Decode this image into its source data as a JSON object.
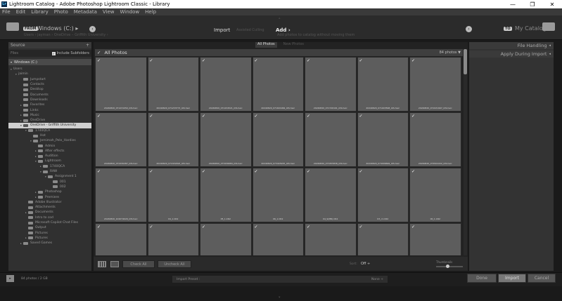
{
  "window": {
    "title": "Lightroom Catalog - Adobe Photoshop Lightroom Classic - Library",
    "app_icon": "Lr",
    "minimize": "—",
    "maximize": "❐",
    "close": "✕"
  },
  "menu": [
    "File",
    "Edit",
    "Library",
    "Photo",
    "Metadata",
    "View",
    "Window",
    "Help"
  ],
  "import_header": {
    "from_badge": "FROM",
    "source": "Windows (C:)",
    "source_arrow": "▸",
    "source_path": "Users › jayman › OneDrive – Griffith University ›",
    "left_nav": "‹",
    "modes": {
      "import": "Import",
      "embedded_culling": "Assisted Culling",
      "add": "Add",
      "add_arrow": "›"
    },
    "mode_description": "Add photos to catalog without moving them",
    "right_nav": "›",
    "to_badge": "TO",
    "destination": "My Catalog"
  },
  "source_panel": {
    "title": "Source",
    "add": "+",
    "filter_label": "Files",
    "include_subfolders_label": "Include Subfolders",
    "include_subfolders_checked": true,
    "volume": "Windows (C:)",
    "tree": [
      {
        "label": "Users",
        "depth": 0,
        "arrow": "▾",
        "folder": false
      },
      {
        "label": "jaimin",
        "depth": 1,
        "arrow": "▾",
        "folder": false
      },
      {
        "label": "Jumpstart",
        "depth": 2,
        "arrow": "",
        "folder": true
      },
      {
        "label": "Contacts",
        "depth": 2,
        "arrow": "",
        "folder": true
      },
      {
        "label": "Desktop",
        "depth": 2,
        "arrow": "",
        "folder": true
      },
      {
        "label": "Documents",
        "depth": 2,
        "arrow": "",
        "folder": true
      },
      {
        "label": "Downloads",
        "depth": 2,
        "arrow": "",
        "folder": true
      },
      {
        "label": "Favorites",
        "depth": 2,
        "arrow": "▸",
        "folder": true
      },
      {
        "label": "Links",
        "depth": 2,
        "arrow": "",
        "folder": true
      },
      {
        "label": "Music",
        "depth": 2,
        "arrow": "▸",
        "folder": true
      },
      {
        "label": "OneDrive",
        "depth": 2,
        "arrow": "▸",
        "folder": true
      },
      {
        "label": "OneDrive - Griffith University",
        "depth": 2,
        "arrow": "▾",
        "folder": true,
        "selected": true
      },
      {
        "label": "1740QCA",
        "depth": 3,
        "arrow": "▾",
        "folder": true
      },
      {
        "label": "Hot",
        "depth": 4,
        "arrow": "",
        "folder": true
      },
      {
        "label": "Jemimah_Pele_Hardies",
        "depth": 4,
        "arrow": "▾",
        "folder": true
      },
      {
        "label": "Admin",
        "depth": 5,
        "arrow": "",
        "folder": true
      },
      {
        "label": "After effects",
        "depth": 5,
        "arrow": "▸",
        "folder": true
      },
      {
        "label": "Audition",
        "depth": 5,
        "arrow": "▸",
        "folder": true
      },
      {
        "label": "Lightroom",
        "depth": 5,
        "arrow": "▾",
        "folder": true
      },
      {
        "label": "1740QCA",
        "depth": 6,
        "arrow": "▸",
        "folder": true
      },
      {
        "label": "RAW",
        "depth": 6,
        "arrow": "▾",
        "folder": true
      },
      {
        "label": "Assignment 1",
        "depth": 7,
        "arrow": "▾",
        "folder": true
      },
      {
        "label": "001",
        "depth": 8,
        "arrow": "",
        "folder": true
      },
      {
        "label": "002",
        "depth": 8,
        "arrow": "",
        "folder": true
      },
      {
        "label": "Photoshop",
        "depth": 5,
        "arrow": "▸",
        "folder": true
      },
      {
        "label": "Premiere",
        "depth": 5,
        "arrow": "▸",
        "folder": true
      },
      {
        "label": "Adobe Illustrator",
        "depth": 3,
        "arrow": "",
        "folder": true
      },
      {
        "label": "Attachments",
        "depth": 3,
        "arrow": "",
        "folder": true
      },
      {
        "label": "Documents",
        "depth": 3,
        "arrow": "▸",
        "folder": true
      },
      {
        "label": "Intro to cod",
        "depth": 3,
        "arrow": "",
        "folder": true
      },
      {
        "label": "Microsoft Copilot Chat Files",
        "depth": 3,
        "arrow": "",
        "folder": true
      },
      {
        "label": "Output",
        "depth": 3,
        "arrow": "",
        "folder": true
      },
      {
        "label": "Pictures",
        "depth": 3,
        "arrow": "",
        "folder": true
      },
      {
        "label": "Pictures",
        "depth": 3,
        "arrow": "▸",
        "folder": true
      },
      {
        "label": "Saved Games",
        "depth": 2,
        "arrow": "▸",
        "folder": true
      }
    ]
  },
  "grid": {
    "tabs": {
      "all": "All Photos",
      "new": "New Photos"
    },
    "header_checkbox": "✓",
    "header_title": "All Photos",
    "sort_label": "84 photos",
    "sort_arrow": "▼",
    "check": "✓",
    "thumbnails": [
      "20240820_071231050_iOS.heic",
      "20240820_071233773_iOS.heic",
      "20240820_071434521_iOS.heic",
      "20240820_071601999_iOS.heic",
      "20240820_071726191_iOS.heic",
      "20240820_071943598_iOS.heic",
      "20240820_071931997_iOS.heic",
      "20240820_072430287_iOS.heic",
      "20240820_072432493_iOS.heic",
      "20240820_073436684_iOS.heic",
      "20240820_073445225_iOS.heic",
      "20240820_073455838_iOS.heic",
      "20240820_074006699_iOS.heic",
      "20240820_074502222_iOS.heic",
      "20240820_102074029_iOS.heic",
      "04_1.CR2",
      "05_1.CR2",
      "06_1.CR2",
      "04_S(MR).CR2",
      "03_c1.CR2",
      "00_1.CR2",
      "",
      "",
      "",
      "",
      "",
      "",
      ""
    ]
  },
  "footer": {
    "grid_view_icon": "grid-view-icon",
    "loupe_view_icon": "loupe-view-icon",
    "check_all": "Check All",
    "uncheck_all": "Uncheck All",
    "sort_label": "Sort:",
    "sort_value": "Off ÷",
    "thumbnails_label": "Thumbnails"
  },
  "right_panel": {
    "file_handling": "File Handling",
    "apply_during_import": "Apply During Import",
    "collapse_glyph": "◂"
  },
  "bottom": {
    "toggle_glyph": "▸",
    "count": "84 photos / 2 GB",
    "import_preset_label": "Import Preset :",
    "import_preset_value": "None ÷",
    "done": "Done",
    "import": "Import",
    "cancel": "Cancel",
    "top_toggle": "▴",
    "bottom_toggle": "▾"
  }
}
